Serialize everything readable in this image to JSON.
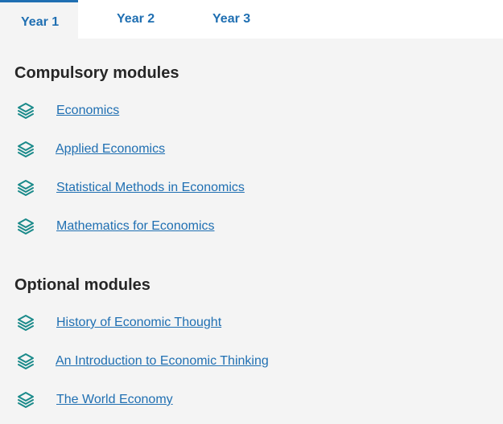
{
  "tabs": [
    {
      "label": "Year 1",
      "active": true
    },
    {
      "label": "Year 2",
      "active": false
    },
    {
      "label": "Year 3",
      "active": false
    }
  ],
  "sections": {
    "compulsory": {
      "title": "Compulsory modules",
      "modules": [
        {
          "label": "Economics",
          "icon": "layers-icon"
        },
        {
          "label": "Applied Economics",
          "icon": "layers-icon"
        },
        {
          "label": "Statistical Methods in Economics",
          "icon": "layers-icon"
        },
        {
          "label": "Mathematics for Economics",
          "icon": "layers-icon"
        }
      ]
    },
    "optional": {
      "title": "Optional modules",
      "modules": [
        {
          "label": "History of Economic Thought",
          "icon": "layers-icon"
        },
        {
          "label": "An Introduction to Economic Thinking",
          "icon": "layers-icon"
        },
        {
          "label": "The World Economy",
          "icon": "layers-icon"
        }
      ]
    }
  },
  "colors": {
    "accent": "#1f6fb2",
    "icon": "#1a8a8a",
    "panel_bg": "#f4f4f4",
    "heading": "#262626"
  }
}
